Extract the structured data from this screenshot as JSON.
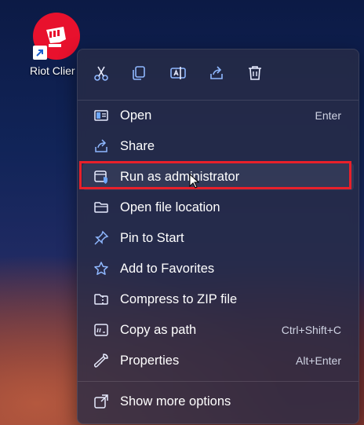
{
  "desktop": {
    "icon_label": "Riot Clier",
    "icon_name": "riot-fist-logo",
    "brand_color": "#e8112d"
  },
  "context_menu": {
    "quick_actions": [
      {
        "name": "cut",
        "icon": "scissors-icon"
      },
      {
        "name": "copy",
        "icon": "copy-icon"
      },
      {
        "name": "rename",
        "icon": "rename-icon"
      },
      {
        "name": "share",
        "icon": "share-icon"
      },
      {
        "name": "delete",
        "icon": "trash-icon"
      }
    ],
    "items": [
      {
        "label": "Open",
        "shortcut": "Enter",
        "icon": "open-app-icon"
      },
      {
        "label": "Share",
        "shortcut": "",
        "icon": "share-icon"
      },
      {
        "label": "Run as administrator",
        "shortcut": "",
        "icon": "shield-window-icon"
      },
      {
        "label": "Open file location",
        "shortcut": "",
        "icon": "folder-icon"
      },
      {
        "label": "Pin to Start",
        "shortcut": "",
        "icon": "pin-icon"
      },
      {
        "label": "Add to Favorites",
        "shortcut": "",
        "icon": "star-icon"
      },
      {
        "label": "Compress to ZIP file",
        "shortcut": "",
        "icon": "zip-folder-icon"
      },
      {
        "label": "Copy as path",
        "shortcut": "Ctrl+Shift+C",
        "icon": "copy-path-icon"
      },
      {
        "label": "Properties",
        "shortcut": "Alt+Enter",
        "icon": "wrench-icon"
      }
    ],
    "footer_item": {
      "label": "Show more options",
      "icon": "more-options-icon"
    },
    "highlight_color": "#e8202a",
    "accent_color": "#6ea8ff"
  }
}
